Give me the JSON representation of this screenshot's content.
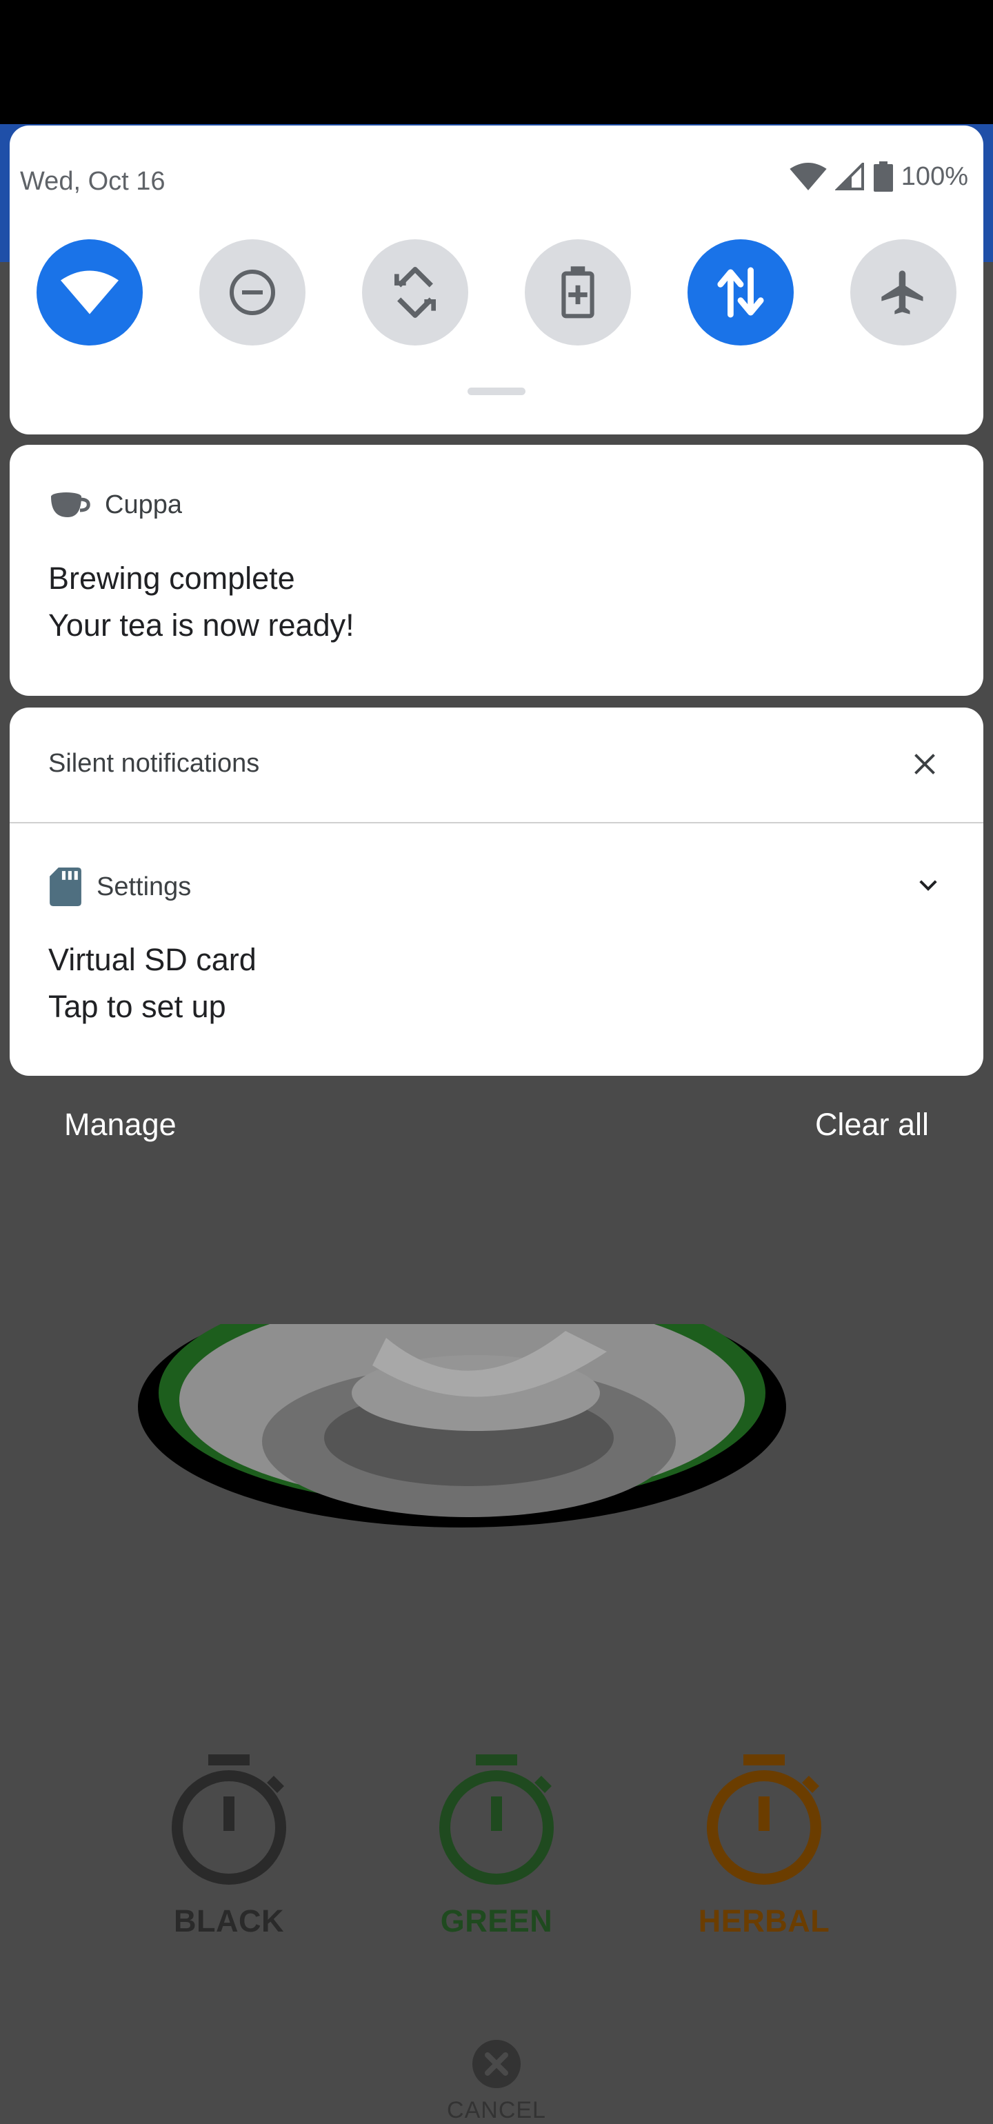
{
  "status": {
    "date": "Wed, Oct 16",
    "battery_label": "100%",
    "icons": [
      "wifi-icon",
      "signal-icon",
      "battery-icon"
    ]
  },
  "quick_settings": [
    {
      "name": "wifi",
      "icon": "wifi-icon",
      "active": true
    },
    {
      "name": "do-not-disturb",
      "icon": "minus-circle-icon",
      "active": false
    },
    {
      "name": "auto-rotate",
      "icon": "rotate-icon",
      "active": false
    },
    {
      "name": "battery-saver",
      "icon": "battery-plus-icon",
      "active": false
    },
    {
      "name": "mobile-data",
      "icon": "data-arrows-icon",
      "active": true
    },
    {
      "name": "airplane-mode",
      "icon": "airplane-icon",
      "active": false
    }
  ],
  "notification_cuppa": {
    "app": "Cuppa",
    "title": "Brewing complete",
    "text": "Your tea is now ready!"
  },
  "silent_section": {
    "header": "Silent notifications",
    "settings_notification": {
      "app": "Settings",
      "title": "Virtual SD card",
      "text": "Tap to set up"
    }
  },
  "footer": {
    "manage": "Manage",
    "clear_all": "Clear all"
  },
  "background_app": {
    "timers": [
      {
        "label": "BLACK",
        "color": "#2a2a2a"
      },
      {
        "label": "GREEN",
        "color": "#1f4a1f"
      },
      {
        "label": "HERBAL",
        "color": "#6b3d00"
      }
    ],
    "cancel_label": "CANCEL"
  },
  "colors": {
    "accent": "#1a73e8",
    "tile_off": "#dadce0",
    "scrim_bg": "#4a4a4a"
  }
}
